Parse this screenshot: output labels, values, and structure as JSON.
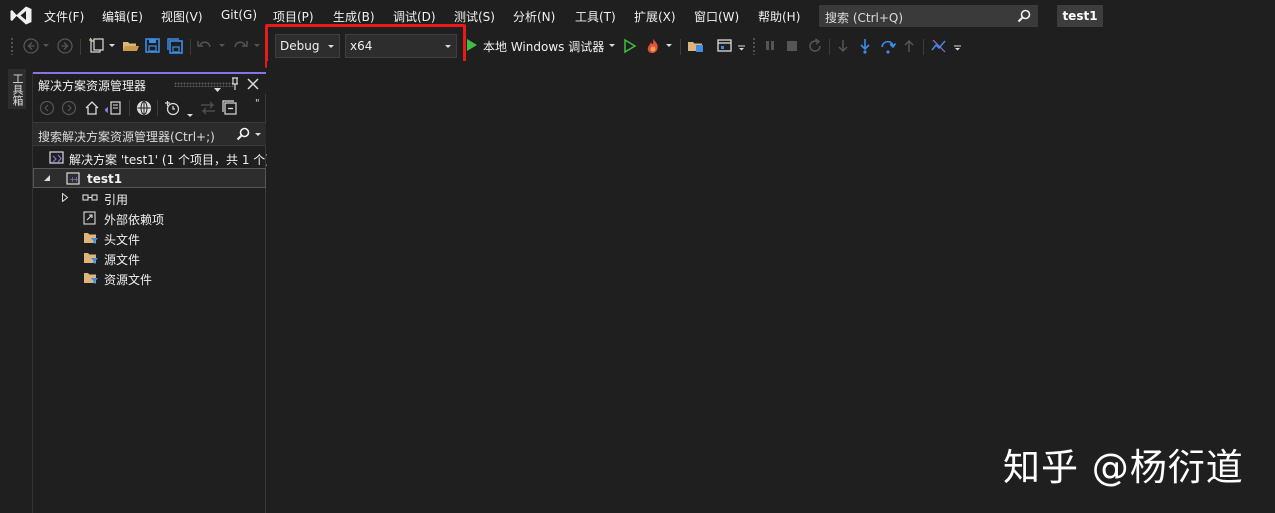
{
  "menu": {
    "items": [
      "文件(F)",
      "编辑(E)",
      "视图(V)",
      "Git(G)",
      "项目(P)",
      "生成(B)",
      "调试(D)",
      "测试(S)",
      "分析(N)",
      "工具(T)",
      "扩展(X)",
      "窗口(W)",
      "帮助(H)"
    ],
    "search_placeholder": "搜索 (Ctrl+Q)",
    "solution_badge": "test1"
  },
  "toolbar": {
    "configuration": "Debug",
    "platform": "x64",
    "run_target": "本地 Windows 调试器"
  },
  "toolbox": {
    "tab_label": "工具箱"
  },
  "solution_explorer": {
    "title": "解决方案资源管理器",
    "search_placeholder": "搜索解决方案资源管理器(Ctrl+;)",
    "solution_node": "解决方案 'test1' (1 个项目，共 1 个)",
    "project_node": "test1",
    "children": [
      "引用",
      "外部依赖项",
      "头文件",
      "源文件",
      "资源文件"
    ]
  },
  "watermark": "知乎 @杨衍道",
  "colors": {
    "background": "#1f1f1f",
    "highlight_frame": "#e81a1a",
    "panel_accent": "#8c74e0",
    "run_green": "#3fbf3f",
    "folder_yellow": "#dcb67a",
    "save_blue": "#3c8ce8"
  }
}
